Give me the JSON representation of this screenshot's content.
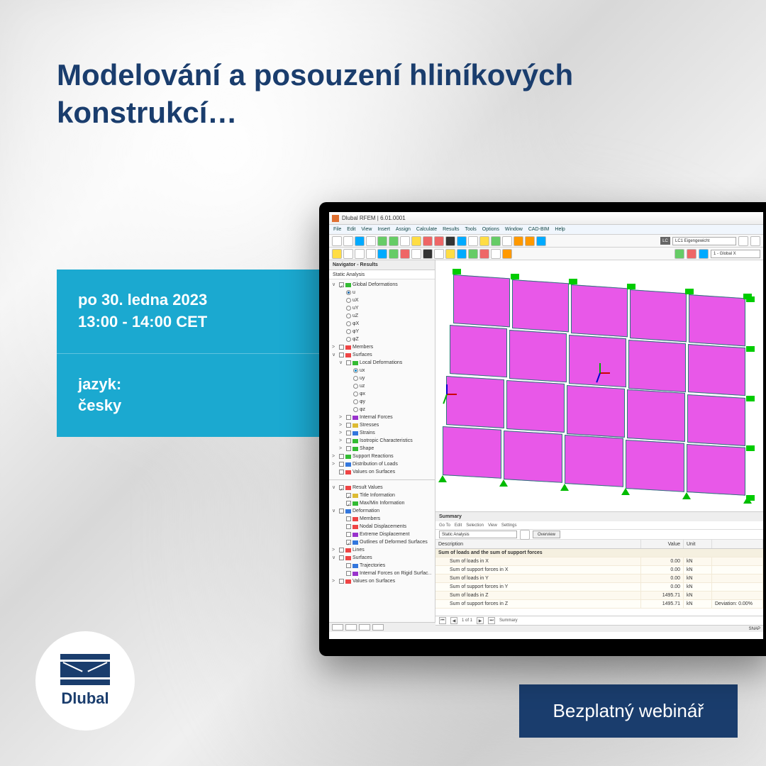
{
  "headline": "Modelování a posouzení hliníkových konstrukcí…",
  "info": {
    "date": "po 30. ledna 2023",
    "time": "13:00 - 14:00 CET",
    "lang_label": "jazyk:",
    "lang_value": "česky"
  },
  "brand": "Dlubal",
  "cta": "Bezplatný webinář",
  "app": {
    "title": "Dlubal RFEM | 6.01.0001",
    "menu": [
      "File",
      "Edit",
      "View",
      "Insert",
      "Assign",
      "Calculate",
      "Results",
      "Tools",
      "Options",
      "Window",
      "CAD-BIM",
      "Help"
    ],
    "lc_badge": "LC",
    "lc_field": "LC1   Eigengewicht",
    "global_combo": "1 - Global X",
    "navigator": {
      "title": "Navigator - Results",
      "subtitle": "Static Analysis",
      "tree_top": [
        {
          "ind": 0,
          "exp": "∨",
          "chk": true,
          "ico": "t-grn",
          "label": "Global Deformations"
        },
        {
          "ind": 1,
          "rad": true,
          "radon": true,
          "label": "u"
        },
        {
          "ind": 1,
          "rad": true,
          "label": "uX"
        },
        {
          "ind": 1,
          "rad": true,
          "label": "uY"
        },
        {
          "ind": 1,
          "rad": true,
          "label": "uZ"
        },
        {
          "ind": 1,
          "rad": true,
          "label": "φX"
        },
        {
          "ind": 1,
          "rad": true,
          "label": "φY"
        },
        {
          "ind": 1,
          "rad": true,
          "label": "φZ"
        },
        {
          "ind": 0,
          "exp": ">",
          "chk": false,
          "ico": "t-red",
          "label": "Members"
        },
        {
          "ind": 0,
          "exp": "∨",
          "chk": false,
          "ico": "t-red",
          "label": "Surfaces"
        },
        {
          "ind": 1,
          "exp": "∨",
          "chk": false,
          "ico": "t-grn",
          "label": "Local Deformations"
        },
        {
          "ind": 2,
          "rad": true,
          "radsel": true,
          "label": "ux"
        },
        {
          "ind": 2,
          "rad": true,
          "label": "uy"
        },
        {
          "ind": 2,
          "rad": true,
          "label": "uz"
        },
        {
          "ind": 2,
          "rad": true,
          "label": "φx"
        },
        {
          "ind": 2,
          "rad": true,
          "label": "φy"
        },
        {
          "ind": 2,
          "rad": true,
          "label": "φz"
        },
        {
          "ind": 1,
          "exp": ">",
          "chk": false,
          "ico": "t-pur",
          "label": "Internal Forces"
        },
        {
          "ind": 1,
          "exp": ">",
          "chk": false,
          "ico": "t-ylw",
          "label": "Stresses"
        },
        {
          "ind": 1,
          "exp": ">",
          "chk": false,
          "ico": "t-blu",
          "label": "Strains"
        },
        {
          "ind": 1,
          "exp": ">",
          "chk": false,
          "ico": "t-grn",
          "label": "Isotropic Characteristics"
        },
        {
          "ind": 1,
          "exp": ">",
          "chk": false,
          "ico": "t-grn",
          "label": "Shape"
        },
        {
          "ind": 0,
          "exp": ">",
          "chk": false,
          "ico": "t-grn",
          "label": "Support Reactions"
        },
        {
          "ind": 0,
          "exp": ">",
          "chk": false,
          "ico": "t-blu",
          "label": "Distribution of Loads"
        },
        {
          "ind": 0,
          "exp": "",
          "chk": false,
          "ico": "t-red",
          "label": "Values on Surfaces"
        }
      ],
      "tree_bottom": [
        {
          "ind": 0,
          "exp": "∨",
          "chk": true,
          "ico": "t-red",
          "label": "Result Values"
        },
        {
          "ind": 1,
          "chk": true,
          "ico": "t-ylw",
          "label": "Title Information"
        },
        {
          "ind": 1,
          "chk": true,
          "ico": "t-grn",
          "label": "Max/Min Information"
        },
        {
          "ind": 0,
          "exp": "∨",
          "chk": false,
          "ico": "t-blu",
          "label": "Deformation"
        },
        {
          "ind": 1,
          "chk": false,
          "ico": "t-red",
          "label": "Members"
        },
        {
          "ind": 1,
          "chk": false,
          "ico": "t-red",
          "label": "Nodal Displacements"
        },
        {
          "ind": 1,
          "chk": false,
          "ico": "t-pur",
          "label": "Extreme Displacement"
        },
        {
          "ind": 1,
          "chk": true,
          "ico": "t-blu",
          "label": "Outlines of Deformed Surfaces"
        },
        {
          "ind": 0,
          "exp": ">",
          "chk": false,
          "ico": "t-red",
          "label": "Lines"
        },
        {
          "ind": 0,
          "exp": "∨",
          "chk": false,
          "ico": "t-red",
          "label": "Surfaces"
        },
        {
          "ind": 1,
          "chk": false,
          "ico": "t-blu",
          "label": "Trajectories"
        },
        {
          "ind": 1,
          "chk": false,
          "ico": "t-pur",
          "label": "Internal Forces on Rigid Surfac…"
        },
        {
          "ind": 0,
          "exp": ">",
          "chk": false,
          "ico": "t-red",
          "label": "Values on Surfaces"
        }
      ]
    },
    "summary": {
      "title": "Summary",
      "menu": [
        "Go To",
        "Edit",
        "Selection",
        "View",
        "Settings"
      ],
      "combo": "Static Analysis",
      "tab": "Overview",
      "columns": {
        "desc": "Description",
        "value": "Value",
        "unit": "Unit"
      },
      "group": "Sum of loads and the sum of support forces",
      "rows": [
        {
          "d": "Sum of loads in X",
          "v": "0.00",
          "u": "kN"
        },
        {
          "d": "Sum of support forces in X",
          "v": "0.00",
          "u": "kN"
        },
        {
          "d": "Sum of loads in Y",
          "v": "0.00",
          "u": "kN"
        },
        {
          "d": "Sum of support forces in Y",
          "v": "0.00",
          "u": "kN"
        },
        {
          "d": "Sum of loads in Z",
          "v": "1495.71",
          "u": "kN"
        },
        {
          "d": "Sum of support forces in Z",
          "v": "1495.71",
          "u": "kN",
          "extra": "Deviation: 0.00%"
        }
      ],
      "pager": {
        "pos": "1 of 1",
        "tab": "Summary"
      }
    },
    "status": "SNAP"
  }
}
